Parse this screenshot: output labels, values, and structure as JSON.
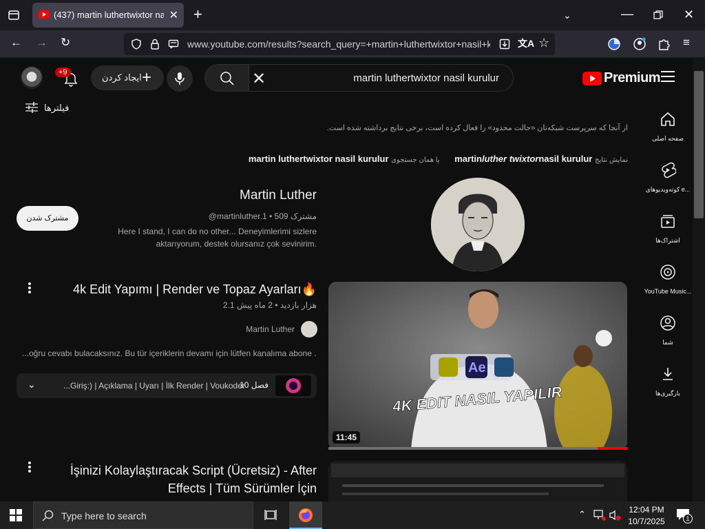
{
  "browser": {
    "tab_title": "(437) martin luthertwixtor nasil",
    "url": "www.youtube.com/results?search_query=+martin+luthertwixtor+nasil+k"
  },
  "header": {
    "notifications_badge": "+9",
    "create_label": "ایجاد کردن",
    "search_value": "martin luthertwixtor nasil kurulur",
    "logo_text": "Premium"
  },
  "filters_label": "فیلترها",
  "notice": "از آنجا که سرپرست شبکه‌تان «حالت محدود» را فعال کرده است، برخی نتایج برداشته شده است.",
  "spelling": {
    "showing_label": "نمایش نتایج",
    "corrected_part1": "martin",
    "corrected_part2": "luther twixtor",
    "corrected_part3": "nasil kurulur",
    "instead_label": "یا همان جستجوی",
    "original": "martin luthertwixtor nasil kurulur"
  },
  "sidebar": {
    "items": [
      {
        "label": "صفحه اصلی",
        "icon": "home-icon"
      },
      {
        "label": "کوته‌ویدیوهای e...",
        "icon": "shorts-icon"
      },
      {
        "label": "اشتراک‌ها",
        "icon": "subscriptions-icon"
      },
      {
        "label": "YouTube Music...",
        "icon": "music-icon"
      },
      {
        "label": "شما",
        "icon": "account-icon"
      },
      {
        "label": "بارگیری‌ها",
        "icon": "download-icon"
      }
    ]
  },
  "channel": {
    "name": "Martin Luther",
    "meta": "@martinluther.1 • 509 مشترک",
    "description": "Here I stand, I can do no other... Deneyimlerimi sizlere aktarıyorum, destek olursanız çok sevinirim.",
    "subscribe_label": "مشترک شدن"
  },
  "videos": [
    {
      "title": "4k Edit Yapımı | Render ve Topaz Ayarları🔥",
      "meta": "2.1 هزار بازدید • 2 ماه پیش",
      "channel": "Martin Luther",
      "description": "...oğru cevabı bulacaksınız. Bu tür içeriklerin devamı için lütfen kanalıma abone ...",
      "duration": "11:45",
      "thumb_caption": "4K EDIT NASIL YAPILIR",
      "thumb_ae_label": "Ae",
      "watch_progress": 0.1,
      "chapters_count": "10 فصل",
      "chapters_list": "Giriş:) | Açıklama | Uyarı | İlk Render | Voukoder..."
    },
    {
      "title": "İşinizi Kolaylaştıracak Script (Ücretsiz) - After Effects | Tüm Sürümler İçin"
    }
  ],
  "taskbar": {
    "search_placeholder": "Type here to search",
    "time": "12:04 PM",
    "date": "10/7/2025",
    "notification_count": "1"
  },
  "colors": {
    "yt_red": "#ff0000",
    "background": "#0f0f0f",
    "accent_badge": "#cc0000"
  }
}
